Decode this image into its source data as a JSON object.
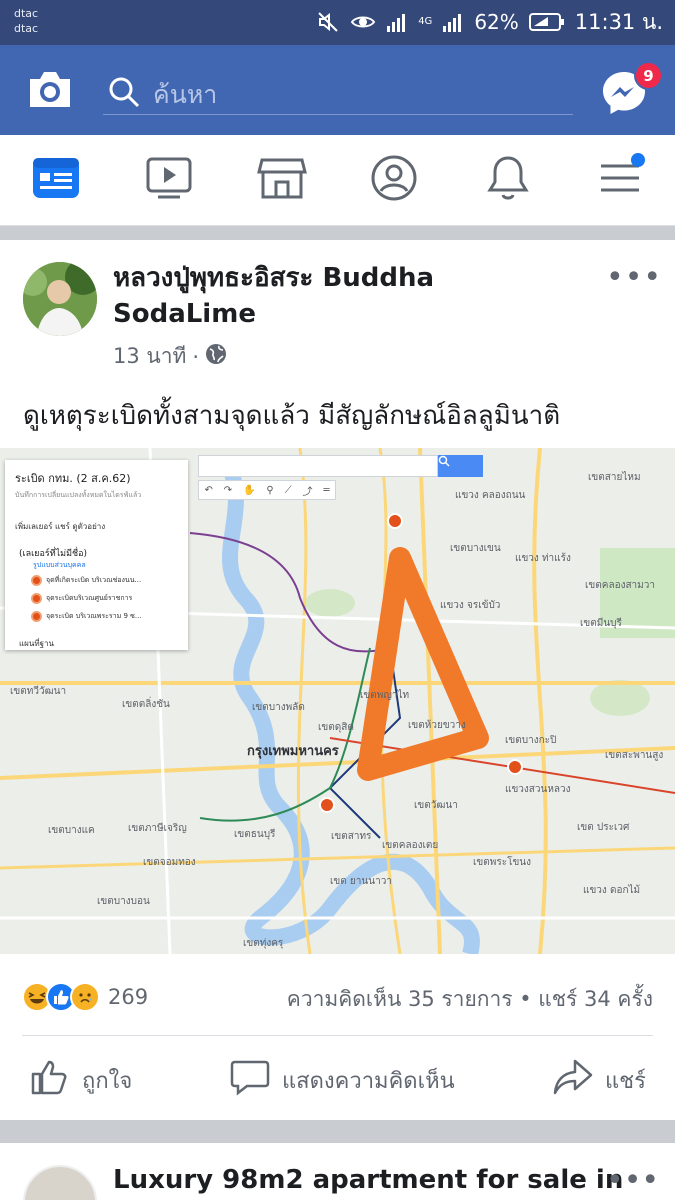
{
  "status_bar": {
    "carrier_line1": "dtac",
    "carrier_line2": "dtac",
    "signal_type": "4G",
    "battery": "62%",
    "clock": "11:31 น.",
    "icons": [
      "mute-icon",
      "eye-icon",
      "signal-icon",
      "battery-icon"
    ]
  },
  "header": {
    "search_placeholder": "ค้นหา",
    "messenger_badge": "9",
    "icons": [
      "camera-icon",
      "search-icon",
      "messenger-icon"
    ]
  },
  "tabs": [
    {
      "name": "news-feed",
      "icon": "news-feed-icon",
      "active": true
    },
    {
      "name": "watch",
      "icon": "video-icon",
      "active": false
    },
    {
      "name": "marketplace",
      "icon": "store-icon",
      "active": false
    },
    {
      "name": "profile",
      "icon": "profile-icon",
      "active": false
    },
    {
      "name": "notifications",
      "icon": "bell-icon",
      "active": false
    },
    {
      "name": "menu",
      "icon": "menu-icon",
      "active": false,
      "has_dot": true
    }
  ],
  "post": {
    "author": "หลวงปู่พุทธะอิสระ Buddha SodaLime",
    "time": "13 นาที",
    "privacy_icon": "globe-icon",
    "text": "ดูเหตุระเบิดทั้งสามจุดแล้ว มีสัญลักษณ์อิลลูมินาติ",
    "map": {
      "panel_title": "ระเบิด กทม. (2 ส.ค.62)",
      "panel_subtitle": "บันทึกการเปลี่ยนแปลงทั้งหมดในไดรฟ์แล้ว",
      "panel_actions": "เพิ่มเลเยอร์   แชร์   ดูตัวอย่าง",
      "layer_name": "(เลเยอร์ที่ไม่มีชื่อ)",
      "layer_style": "รูปแบบส่วนบุคคล",
      "markers": [
        "จุดที่เกิดระเบิด บริเวณช่องนน...",
        "จุดระเบิดบริเวณศูนย์ราชการ",
        "จุดระเบิด บริเวณพระราม 9 ซ..."
      ],
      "base_layer": "แผนที่ฐาน",
      "city_label": "กรุงเทพมหานคร",
      "district_labels": [
        "เขตสายไหม",
        "แขวง คลองถนน",
        "เขตบางเขน",
        "แขวง ท่าแร้ง",
        "เขตคลองสามวา",
        "แขวง จรเข้บัว",
        "เขตมีนบุรี",
        "เขตทวีวัฒนา",
        "เขตตลิ่งชัน",
        "เขตบางพลัด",
        "เขตดุสิต",
        "เขตพญาไท",
        "เขตห้วยขวาง",
        "เขตบางกะปิ",
        "เขตสะพานสูง",
        "แขวงสวนหลวง",
        "เขตบางแค",
        "เขตภาษีเจริญ",
        "เขตธนบุรี",
        "เขตสาทร",
        "เขตคลองเตย",
        "เขตวัฒนา",
        "เขต ประเวศ",
        "เขตจอมทอง",
        "เขต ยานนาวา",
        "เขตพระโขนง",
        "แขวง ดอกไม้",
        "เขตบางบอน",
        "เขตทุ่งครุ"
      ]
    },
    "reactions_count": "269",
    "reaction_icons": [
      "haha-icon",
      "like-icon",
      "sad-icon"
    ],
    "stats": "ความคิดเห็น 35 รายการ • แชร์ 34 ครั้ง",
    "actions": {
      "like": "ถูกใจ",
      "comment": "แสดงความคิดเห็น",
      "share": "แชร์"
    }
  },
  "next_post": {
    "author": "Luxury 98m2 apartment for sale in"
  },
  "colors": {
    "fb_blue": "#4267b2",
    "status_bar": "#34497a",
    "notification_red": "#f02849",
    "triangle_orange": "#f07a2a"
  }
}
